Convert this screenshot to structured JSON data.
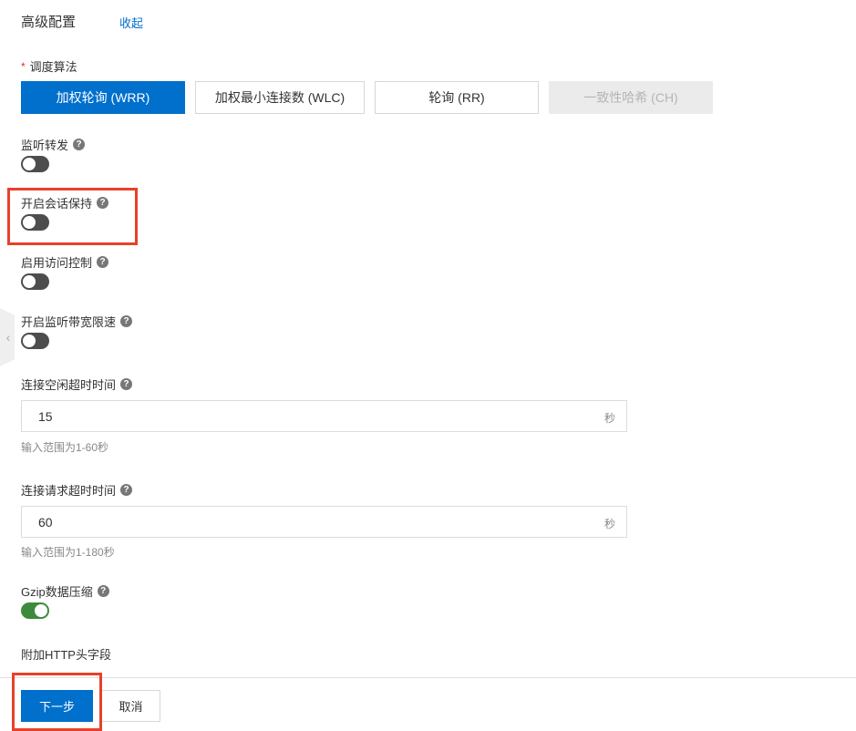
{
  "section": {
    "title": "高级配置",
    "collapse_label": "收起"
  },
  "scheduling": {
    "label": "调度算法",
    "required_mark": "*",
    "options": [
      {
        "label": "加权轮询 (WRR)",
        "state": "selected"
      },
      {
        "label": "加权最小连接数 (WLC)",
        "state": "normal"
      },
      {
        "label": "轮询 (RR)",
        "state": "normal"
      },
      {
        "label": "一致性哈希 (CH)",
        "state": "disabled"
      }
    ]
  },
  "toggles": {
    "listener_forward": {
      "label": "监听转发",
      "on": false
    },
    "session_persistence": {
      "label": "开启会话保持",
      "on": false
    },
    "access_control": {
      "label": "启用访问控制",
      "on": false
    },
    "bandwidth_limit": {
      "label": "开启监听带宽限速",
      "on": false
    },
    "gzip": {
      "label": "Gzip数据压缩",
      "on": true
    }
  },
  "idle_timeout": {
    "label": "连接空闲超时时间",
    "value": "15",
    "unit": "秒",
    "hint": "输入范围为1-60秒"
  },
  "request_timeout": {
    "label": "连接请求超时时间",
    "value": "60",
    "unit": "秒",
    "hint": "输入范围为1-180秒"
  },
  "http_header": {
    "label": "附加HTTP头字段"
  },
  "help_glyph": "?",
  "side_handle_glyph": "‹",
  "footer": {
    "next_label": "下一步",
    "cancel_label": "取消"
  },
  "colors": {
    "primary": "#0070cc",
    "highlight": "#e8402a",
    "toggle_on": "#3e8a3c",
    "toggle_off": "#4d4d4d"
  },
  "icons": {
    "help": "question-circle-icon",
    "side_handle": "chevron-left-icon"
  }
}
